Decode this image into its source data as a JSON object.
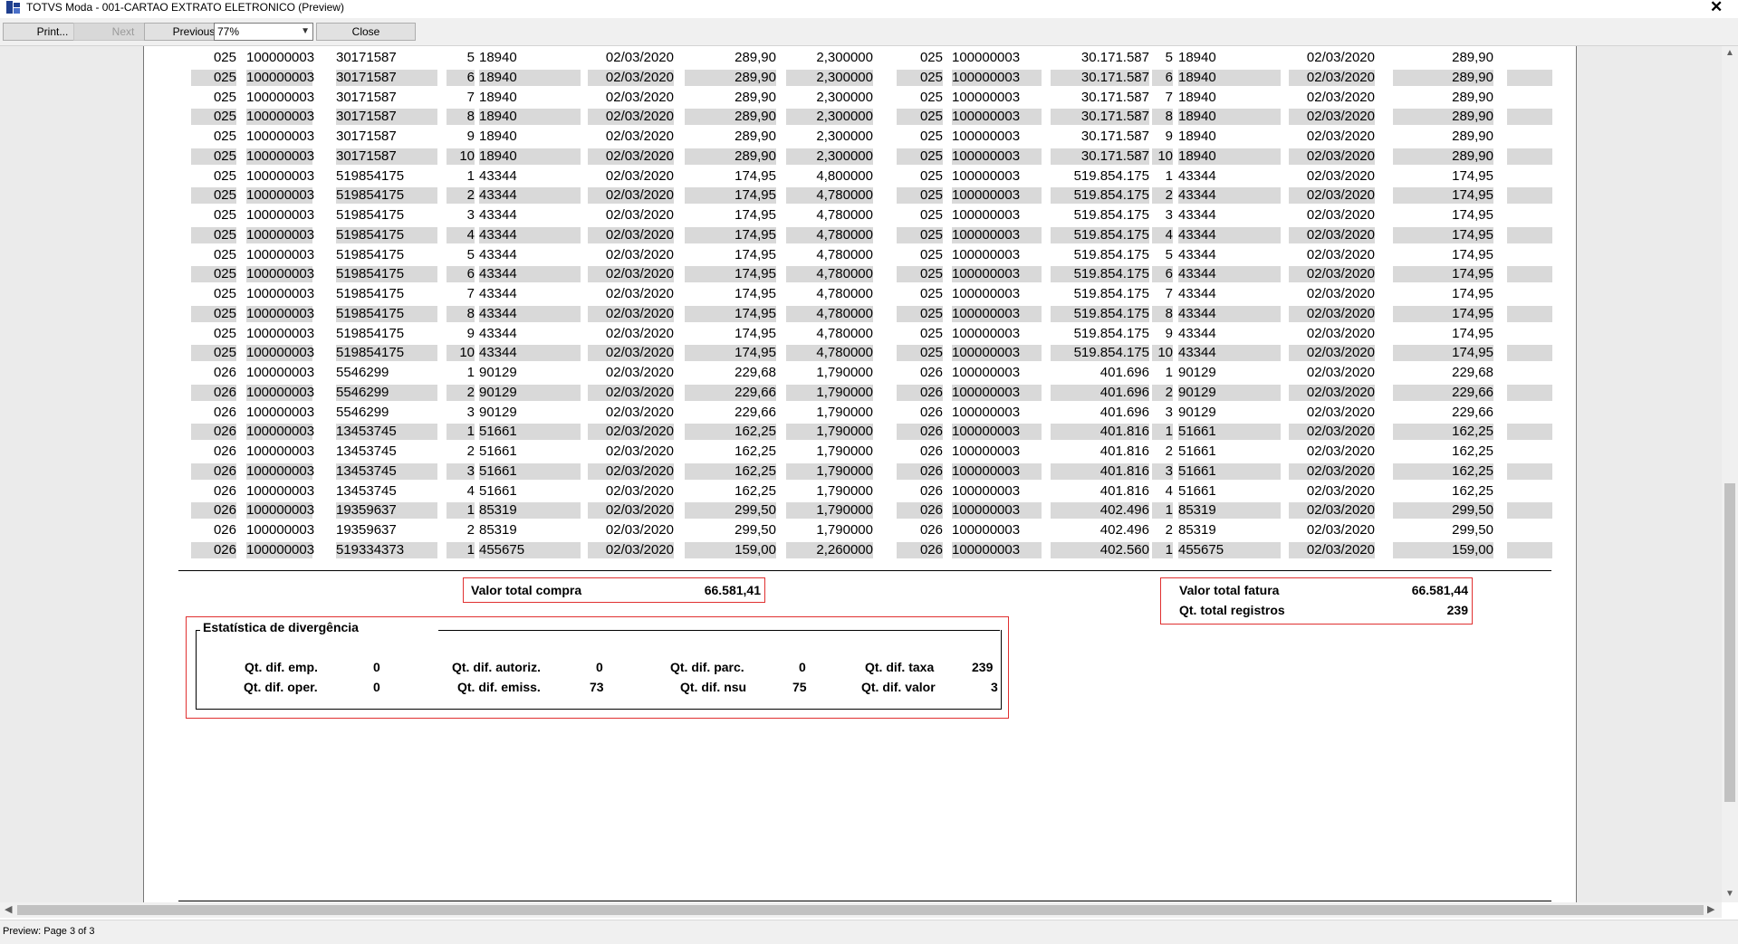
{
  "window": {
    "title": "TOTVS Moda - 001-CARTAO EXTRATO ELETRONICO (Preview)",
    "close_glyph": "✕"
  },
  "toolbar": {
    "print_label": "Print...",
    "next_label": "Next",
    "previous_label": "Previous",
    "zoom_value": "77%",
    "close_label": "Close"
  },
  "report": {
    "rows": [
      {
        "shade": false,
        "left": [
          "025",
          "100000003",
          "30171587",
          "5",
          "18940",
          "02/03/2020",
          "289,90",
          "2,300000"
        ],
        "right": [
          "025",
          "100000003",
          "30.171.587",
          "5",
          "18940",
          "02/03/2020",
          "289,90"
        ]
      },
      {
        "shade": true,
        "left": [
          "025",
          "100000003",
          "30171587",
          "6",
          "18940",
          "02/03/2020",
          "289,90",
          "2,300000"
        ],
        "right": [
          "025",
          "100000003",
          "30.171.587",
          "6",
          "18940",
          "02/03/2020",
          "289,90"
        ]
      },
      {
        "shade": false,
        "left": [
          "025",
          "100000003",
          "30171587",
          "7",
          "18940",
          "02/03/2020",
          "289,90",
          "2,300000"
        ],
        "right": [
          "025",
          "100000003",
          "30.171.587",
          "7",
          "18940",
          "02/03/2020",
          "289,90"
        ]
      },
      {
        "shade": true,
        "left": [
          "025",
          "100000003",
          "30171587",
          "8",
          "18940",
          "02/03/2020",
          "289,90",
          "2,300000"
        ],
        "right": [
          "025",
          "100000003",
          "30.171.587",
          "8",
          "18940",
          "02/03/2020",
          "289,90"
        ]
      },
      {
        "shade": false,
        "left": [
          "025",
          "100000003",
          "30171587",
          "9",
          "18940",
          "02/03/2020",
          "289,90",
          "2,300000"
        ],
        "right": [
          "025",
          "100000003",
          "30.171.587",
          "9",
          "18940",
          "02/03/2020",
          "289,90"
        ]
      },
      {
        "shade": true,
        "left": [
          "025",
          "100000003",
          "30171587",
          "10",
          "18940",
          "02/03/2020",
          "289,90",
          "2,300000"
        ],
        "right": [
          "025",
          "100000003",
          "30.171.587",
          "10",
          "18940",
          "02/03/2020",
          "289,90"
        ]
      },
      {
        "shade": false,
        "left": [
          "025",
          "100000003",
          "519854175",
          "1",
          "43344",
          "02/03/2020",
          "174,95",
          "4,800000"
        ],
        "right": [
          "025",
          "100000003",
          "519.854.175",
          "1",
          "43344",
          "02/03/2020",
          "174,95"
        ]
      },
      {
        "shade": true,
        "left": [
          "025",
          "100000003",
          "519854175",
          "2",
          "43344",
          "02/03/2020",
          "174,95",
          "4,780000"
        ],
        "right": [
          "025",
          "100000003",
          "519.854.175",
          "2",
          "43344",
          "02/03/2020",
          "174,95"
        ]
      },
      {
        "shade": false,
        "left": [
          "025",
          "100000003",
          "519854175",
          "3",
          "43344",
          "02/03/2020",
          "174,95",
          "4,780000"
        ],
        "right": [
          "025",
          "100000003",
          "519.854.175",
          "3",
          "43344",
          "02/03/2020",
          "174,95"
        ]
      },
      {
        "shade": true,
        "left": [
          "025",
          "100000003",
          "519854175",
          "4",
          "43344",
          "02/03/2020",
          "174,95",
          "4,780000"
        ],
        "right": [
          "025",
          "100000003",
          "519.854.175",
          "4",
          "43344",
          "02/03/2020",
          "174,95"
        ]
      },
      {
        "shade": false,
        "left": [
          "025",
          "100000003",
          "519854175",
          "5",
          "43344",
          "02/03/2020",
          "174,95",
          "4,780000"
        ],
        "right": [
          "025",
          "100000003",
          "519.854.175",
          "5",
          "43344",
          "02/03/2020",
          "174,95"
        ]
      },
      {
        "shade": true,
        "left": [
          "025",
          "100000003",
          "519854175",
          "6",
          "43344",
          "02/03/2020",
          "174,95",
          "4,780000"
        ],
        "right": [
          "025",
          "100000003",
          "519.854.175",
          "6",
          "43344",
          "02/03/2020",
          "174,95"
        ]
      },
      {
        "shade": false,
        "left": [
          "025",
          "100000003",
          "519854175",
          "7",
          "43344",
          "02/03/2020",
          "174,95",
          "4,780000"
        ],
        "right": [
          "025",
          "100000003",
          "519.854.175",
          "7",
          "43344",
          "02/03/2020",
          "174,95"
        ]
      },
      {
        "shade": true,
        "left": [
          "025",
          "100000003",
          "519854175",
          "8",
          "43344",
          "02/03/2020",
          "174,95",
          "4,780000"
        ],
        "right": [
          "025",
          "100000003",
          "519.854.175",
          "8",
          "43344",
          "02/03/2020",
          "174,95"
        ]
      },
      {
        "shade": false,
        "left": [
          "025",
          "100000003",
          "519854175",
          "9",
          "43344",
          "02/03/2020",
          "174,95",
          "4,780000"
        ],
        "right": [
          "025",
          "100000003",
          "519.854.175",
          "9",
          "43344",
          "02/03/2020",
          "174,95"
        ]
      },
      {
        "shade": true,
        "left": [
          "025",
          "100000003",
          "519854175",
          "10",
          "43344",
          "02/03/2020",
          "174,95",
          "4,780000"
        ],
        "right": [
          "025",
          "100000003",
          "519.854.175",
          "10",
          "43344",
          "02/03/2020",
          "174,95"
        ]
      },
      {
        "shade": false,
        "left": [
          "026",
          "100000003",
          "5546299",
          "1",
          "90129",
          "02/03/2020",
          "229,68",
          "1,790000"
        ],
        "right": [
          "026",
          "100000003",
          "401.696",
          "1",
          "90129",
          "02/03/2020",
          "229,68"
        ]
      },
      {
        "shade": true,
        "left": [
          "026",
          "100000003",
          "5546299",
          "2",
          "90129",
          "02/03/2020",
          "229,66",
          "1,790000"
        ],
        "right": [
          "026",
          "100000003",
          "401.696",
          "2",
          "90129",
          "02/03/2020",
          "229,66"
        ]
      },
      {
        "shade": false,
        "left": [
          "026",
          "100000003",
          "5546299",
          "3",
          "90129",
          "02/03/2020",
          "229,66",
          "1,790000"
        ],
        "right": [
          "026",
          "100000003",
          "401.696",
          "3",
          "90129",
          "02/03/2020",
          "229,66"
        ]
      },
      {
        "shade": true,
        "left": [
          "026",
          "100000003",
          "13453745",
          "1",
          "51661",
          "02/03/2020",
          "162,25",
          "1,790000"
        ],
        "right": [
          "026",
          "100000003",
          "401.816",
          "1",
          "51661",
          "02/03/2020",
          "162,25"
        ]
      },
      {
        "shade": false,
        "left": [
          "026",
          "100000003",
          "13453745",
          "2",
          "51661",
          "02/03/2020",
          "162,25",
          "1,790000"
        ],
        "right": [
          "026",
          "100000003",
          "401.816",
          "2",
          "51661",
          "02/03/2020",
          "162,25"
        ]
      },
      {
        "shade": true,
        "left": [
          "026",
          "100000003",
          "13453745",
          "3",
          "51661",
          "02/03/2020",
          "162,25",
          "1,790000"
        ],
        "right": [
          "026",
          "100000003",
          "401.816",
          "3",
          "51661",
          "02/03/2020",
          "162,25"
        ]
      },
      {
        "shade": false,
        "left": [
          "026",
          "100000003",
          "13453745",
          "4",
          "51661",
          "02/03/2020",
          "162,25",
          "1,790000"
        ],
        "right": [
          "026",
          "100000003",
          "401.816",
          "4",
          "51661",
          "02/03/2020",
          "162,25"
        ]
      },
      {
        "shade": true,
        "left": [
          "026",
          "100000003",
          "19359637",
          "1",
          "85319",
          "02/03/2020",
          "299,50",
          "1,790000"
        ],
        "right": [
          "026",
          "100000003",
          "402.496",
          "1",
          "85319",
          "02/03/2020",
          "299,50"
        ]
      },
      {
        "shade": false,
        "left": [
          "026",
          "100000003",
          "19359637",
          "2",
          "85319",
          "02/03/2020",
          "299,50",
          "1,790000"
        ],
        "right": [
          "026",
          "100000003",
          "402.496",
          "2",
          "85319",
          "02/03/2020",
          "299,50"
        ]
      },
      {
        "shade": true,
        "left": [
          "026",
          "100000003",
          "519334373",
          "1",
          "455675",
          "02/03/2020",
          "159,00",
          "2,260000"
        ],
        "right": [
          "026",
          "100000003",
          "402.560",
          "1",
          "455675",
          "02/03/2020",
          "159,00"
        ]
      }
    ],
    "totals_left": {
      "label": "Valor total compra",
      "value": "66.581,41"
    },
    "totals_right": {
      "fatura_label": "Valor total fatura",
      "fatura_value": "66.581,44",
      "registros_label": "Qt. total registros",
      "registros_value": "239"
    },
    "stats": {
      "title": "Estatística de divergência",
      "emp_label": "Qt. dif. emp.",
      "emp_value": "0",
      "autoriz_label": "Qt. dif. autoriz.",
      "autoriz_value": "0",
      "parc_label": "Qt. dif. parc.",
      "parc_value": "0",
      "taxa_label": "Qt. dif. taxa",
      "taxa_value": "239",
      "oper_label": "Qt. dif. oper.",
      "oper_value": "0",
      "emiss_label": "Qt. dif. emiss.",
      "emiss_value": "73",
      "nsu_label": "Qt. dif. nsu",
      "nsu_value": "75",
      "valor_label": "Qt. dif. valor",
      "valor_value": "3"
    }
  },
  "statusbar": {
    "text": "Preview: Page 3 of 3"
  },
  "colors": {
    "highlight_border": "#e03030",
    "row_shade": "#d9d9d9"
  }
}
